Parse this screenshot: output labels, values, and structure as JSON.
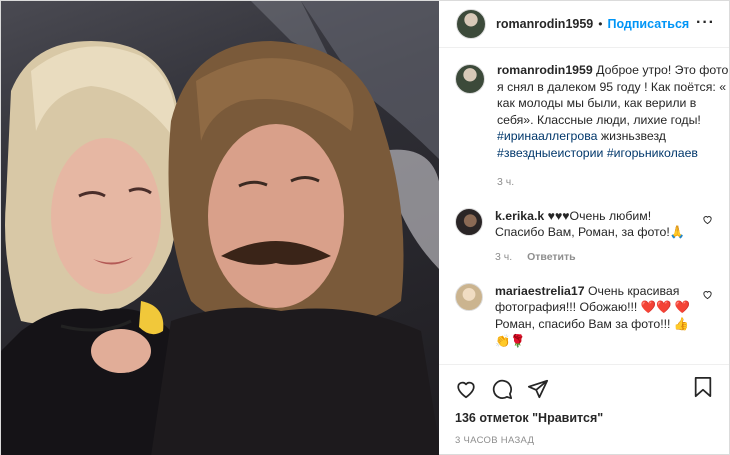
{
  "post": {
    "username": "romanrodin1959",
    "dot": "•",
    "follow_label": "Подписаться",
    "more_label": "···"
  },
  "caption": {
    "username": "romanrodin1959",
    "text": "Доброе утро! Это фото я снял в далеком 95 году ! Как поётся: « как молоды мы были, как верили в себя». Классные люди, лихие годы!",
    "tag1": "#ирина­аллегрова",
    "text2": "жизньзвезд",
    "tag2": "#звездныеистории",
    "tag3": "#игорьниколаев",
    "time": "3 ч."
  },
  "comments": [
    {
      "username": "k.erika.k",
      "text": "♥♥♥Очень любим! Спасибо Вам, Роман, за фото!🙏",
      "time": "3 ч.",
      "reply": "Ответить"
    },
    {
      "username": "mariaestrelia17",
      "text": "Очень красивая фотография!!! Обожаю!!! ❤️❤️ ❤️ Роман, спасибо Вам за фото!!! 👍👏🌹"
    }
  ],
  "footer": {
    "likes": "136 отметок \"Нравится\"",
    "ago": "3 ЧАСОВ НАЗАД"
  },
  "icons": [
    "more-icon",
    "heart-icon",
    "comment-icon",
    "share-icon",
    "save-icon",
    "small-heart-icon"
  ]
}
